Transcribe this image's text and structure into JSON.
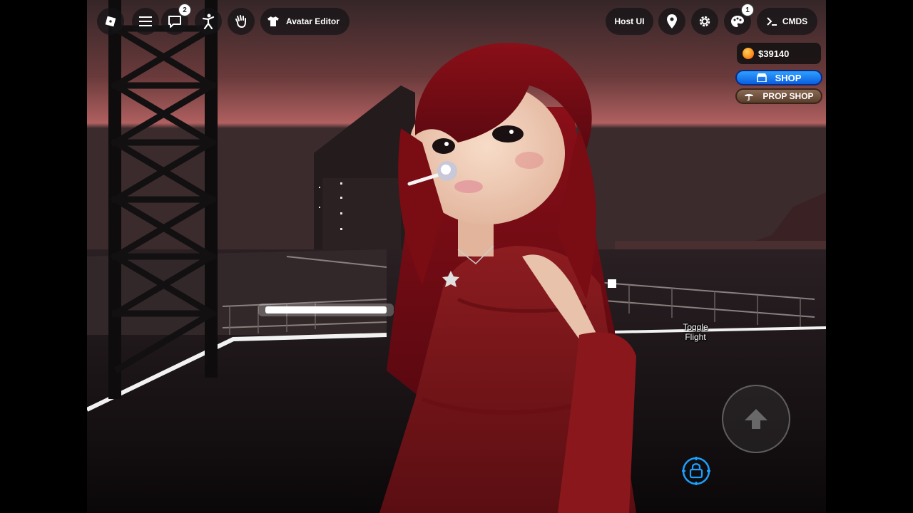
{
  "topbar": {
    "roblox_menu_icon": "roblox-logo-icon",
    "menu_icon": "hamburger-icon",
    "chat_icon": "chat-icon",
    "chat_badge": "2",
    "emote_icon": "emote-figure-icon",
    "wave_icon": "wave-hand-icon",
    "avatar_editor_label": "Avatar Editor",
    "host_ui_label": "Host UI",
    "location_icon": "map-pin-icon",
    "settings_icon": "gear-icon",
    "palette_icon": "paint-palette-icon",
    "palette_badge": "1",
    "cmds_label": "CMDS"
  },
  "hud": {
    "money": "$39140",
    "shop_label": "SHOP",
    "prop_shop_label": "PROP SHOP"
  },
  "controls": {
    "toggle_flight_line1": "Toggle",
    "toggle_flight_line2": "Flight",
    "jump_icon": "up-arrow-icon",
    "shift_lock_icon": "shift-lock-icon"
  },
  "colors": {
    "shop_blue": "#1a7dff",
    "prop_shop_brown": "#6b4a36",
    "lock_blue": "#1aa0ff",
    "dress_red": "#8a1a1e",
    "hair_red": "#7a0c14"
  }
}
